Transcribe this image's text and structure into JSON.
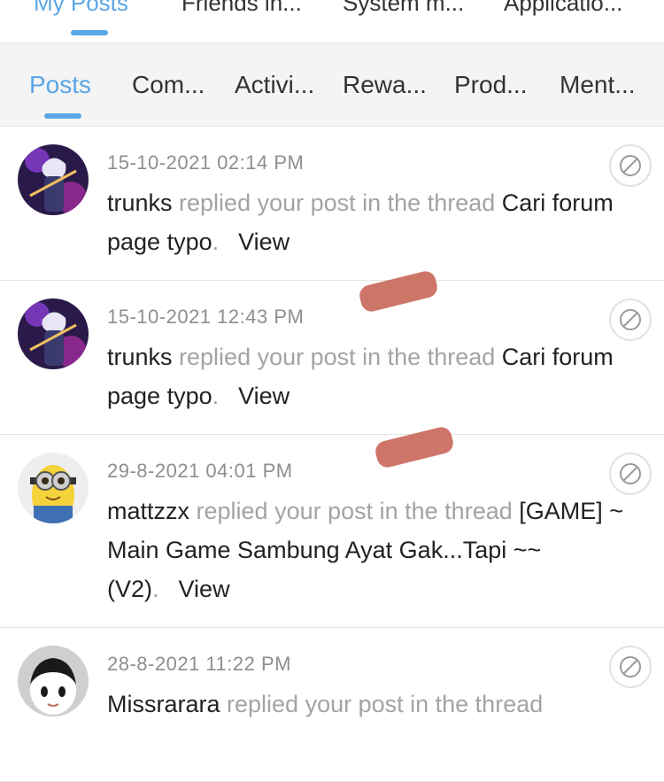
{
  "top_tabs": [
    {
      "label": "My Posts",
      "active": true
    },
    {
      "label": "Friends in...",
      "active": false
    },
    {
      "label": "System m...",
      "active": false
    },
    {
      "label": "Applicatio...",
      "active": false
    }
  ],
  "sub_tabs": [
    {
      "label": "Posts",
      "active": true
    },
    {
      "label": "Com...",
      "active": false
    },
    {
      "label": "Activi...",
      "active": false
    },
    {
      "label": "Rewa...",
      "active": false
    },
    {
      "label": "Prod...",
      "active": false
    },
    {
      "label": "Ment...",
      "active": false
    }
  ],
  "notifications": [
    {
      "time": "15-10-2021 02:14 PM",
      "user": "trunks",
      "action": " replied your post in the thread ",
      "thread": "Cari forum page typo",
      "period": ".",
      "view": "View",
      "avatar": "anime-character-avatar"
    },
    {
      "time": "15-10-2021 12:43 PM",
      "user": "trunks",
      "action": " replied your post in the thread ",
      "thread": "Cari forum page typo",
      "period": ".",
      "view": "View",
      "avatar": "anime-character-avatar"
    },
    {
      "time": "29-8-2021 04:01 PM",
      "user": "mattzzx",
      "action": " replied your post in the thread ",
      "thread": "[GAME] ~ Main Game Sambung Ayat Gak...Tapi ~~(V2)",
      "period": ".",
      "view": "View",
      "avatar": "minion-avatar"
    },
    {
      "time": "28-8-2021 11:22 PM",
      "user": "Missrarara",
      "action": " replied your post in the thread",
      "thread": "",
      "period": "",
      "view": "",
      "avatar": "cartoon-girl-avatar"
    }
  ],
  "colors": {
    "accent": "#5aa6e6",
    "muted_text": "#a3a3a3",
    "smudge": "#c9665a"
  },
  "icons": {
    "mute": "block-circle-icon"
  }
}
